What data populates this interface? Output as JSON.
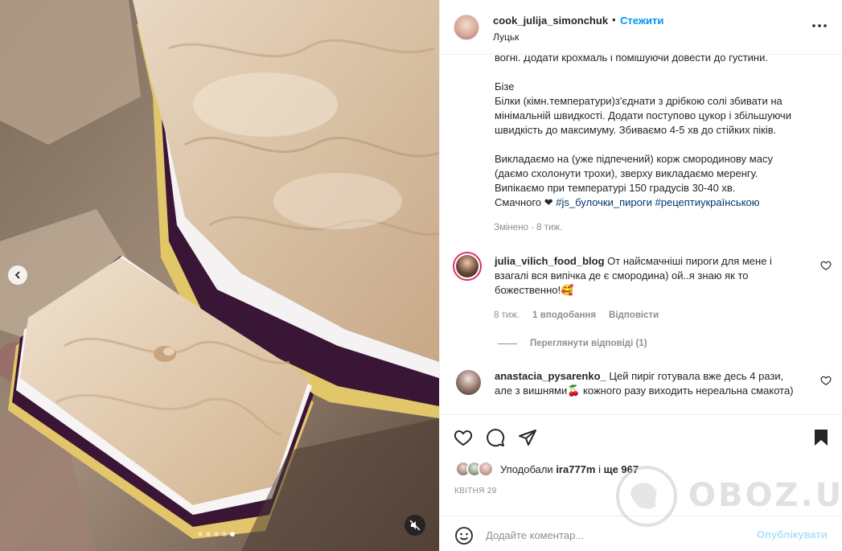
{
  "header": {
    "username": "cook_julija_simonchuk",
    "separator": "•",
    "follow_label": "Стежити",
    "location": "Луцьк",
    "more_label": "•••"
  },
  "caption": {
    "cut_line": "вогні. Додати крохмаль і помішуючи довести до густини.",
    "beze_title": "Бізе",
    "beze_line1": "Білки (кімн.температури)з'єднати з дрібкою солі збивати на",
    "beze_line2": "мінімальній швидкості. Додати поступово цукор і збільшуючи",
    "beze_line3": "швидкість до максимуму. Збиваємо 4-5 хв до стійких піків.",
    "final_line1": "Викладаємо на (уже підпечений) корж смородинову масу",
    "final_line2": "(даємо схолонути трохи), зверху викладаємо меренгу.",
    "final_line3": "Випікаємо при температурі 150 градусів 30-40 хв.",
    "final_line4_prefix": "Смачного ❤ ",
    "hashtag1": "#js_булочки_пироги",
    "hashtag2": "#рецептиукраїнською",
    "edited_meta": "Змінено · 8 тиж."
  },
  "comments": [
    {
      "username": "julia_vilich_food_blog",
      "line1": "От найсмачніші пироги для мене і",
      "line2": "взагалі вся випічка де є смородина) ой..я знаю як то",
      "line3": "божественно!🥰",
      "time": "8 тиж.",
      "likes": "1 вподобання",
      "reply": "Відповісти",
      "view_replies": "Переглянути відповіді (1)"
    },
    {
      "username": "anastacia_pysarenko_",
      "line1": "Цей пиріг готувала вже десь 4 рази,",
      "line2": "але з вишнями🍒 кожного разу виходить нереальна смакота)"
    }
  ],
  "likes": {
    "prefix": "Уподобали ",
    "user": "ira777m",
    "middle": " і ",
    "count": "ще 967"
  },
  "date": "КВІТНЯ 29",
  "add_comment": {
    "placeholder": "Додайте коментар...",
    "publish_label": "Опублікувати"
  },
  "media": {
    "slides_total": 5,
    "active_slide": 5
  },
  "watermark": {
    "text": "OBOZ.UA"
  },
  "colors": {
    "link_blue": "#0095f6",
    "hashtag": "#00376b",
    "muted": "#8e8e8e",
    "publish_disabled": "#b2dffc"
  },
  "icons": [
    "chevron-left-icon",
    "mute-icon",
    "more-icon",
    "heart-icon",
    "comment-icon",
    "share-icon",
    "bookmark-icon",
    "emoji-icon",
    "globe-icon"
  ]
}
